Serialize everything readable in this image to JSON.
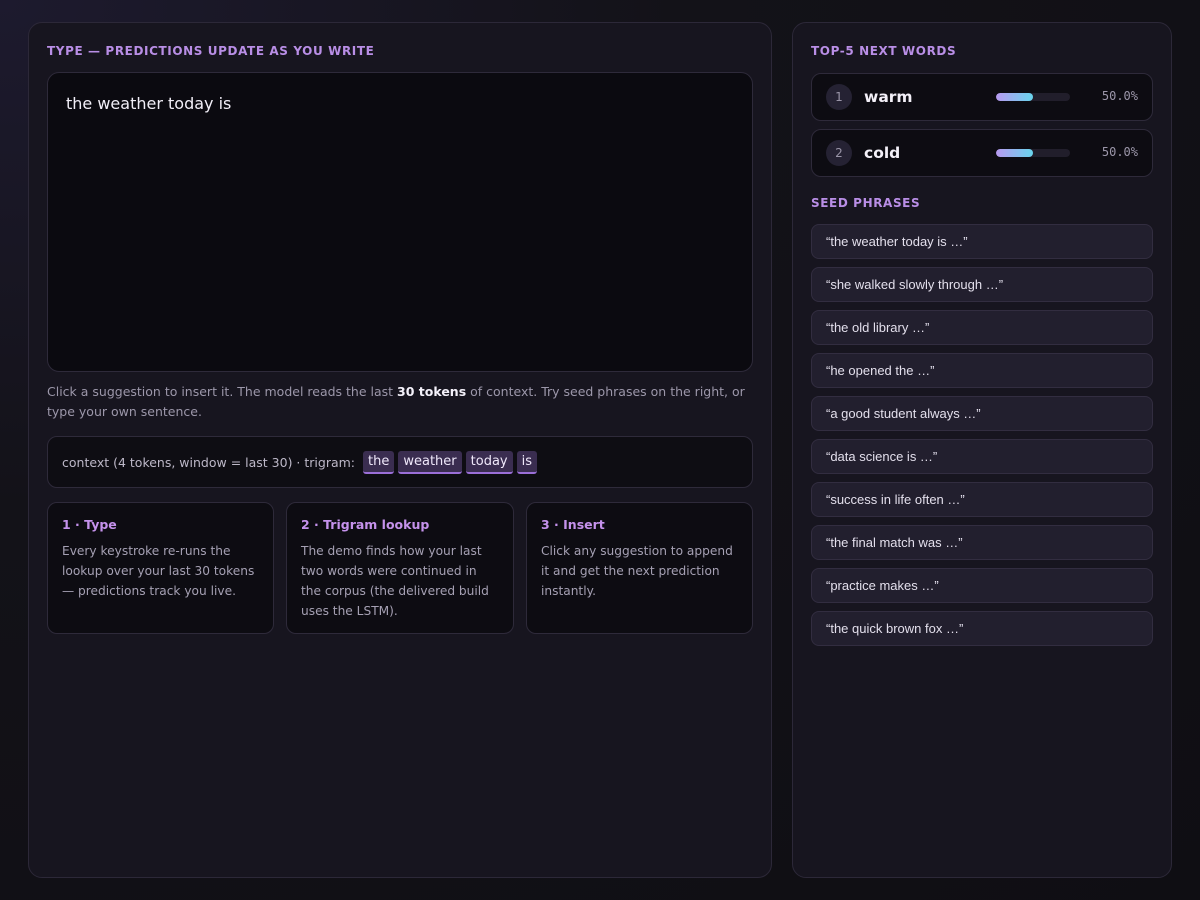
{
  "left": {
    "heading": "TYPE — PREDICTIONS UPDATE AS YOU WRITE",
    "editor_value": "the weather today is",
    "help": {
      "before": "Click a suggestion to insert it. The model reads the last ",
      "bold": "30 tokens",
      "after": " of context. Try seed phrases on the right, or type your own sentence."
    },
    "context": {
      "label": "context (4 tokens, window = last 30) · trigram:",
      "tokens": [
        "the",
        "weather",
        "today",
        "is"
      ]
    },
    "steps": [
      {
        "title": "1 · Type",
        "body": "Every keystroke re-runs the lookup over your last 30 tokens — predictions track you live."
      },
      {
        "title": "2 · Trigram lookup",
        "body": "The demo finds how your last two words were continued in the corpus (the delivered build uses the LSTM)."
      },
      {
        "title": "3 · Insert",
        "body": "Click any suggestion to append it and get the next prediction instantly."
      }
    ]
  },
  "right": {
    "heading": "TOP-5 NEXT WORDS",
    "predictions": [
      {
        "rank": "1",
        "word": "warm",
        "probability": 0.5,
        "pct": "50.0%"
      },
      {
        "rank": "2",
        "word": "cold",
        "probability": 0.5,
        "pct": "50.0%"
      }
    ],
    "seed_heading": "SEED PHRASES",
    "seeds": [
      "“the weather today is …”",
      "“she walked slowly through …”",
      "“the old library …”",
      "“he opened the …”",
      "“a good student always …”",
      "“data science is …”",
      "“success in life often …”",
      "“the final match was …”",
      "“practice makes …”",
      "“the quick brown fox …”"
    ]
  },
  "colors": {
    "accent": "#b98ee6",
    "bar_start": "#b89af0",
    "bar_end": "#68d4ec",
    "token_bg": "#3a2d50"
  }
}
